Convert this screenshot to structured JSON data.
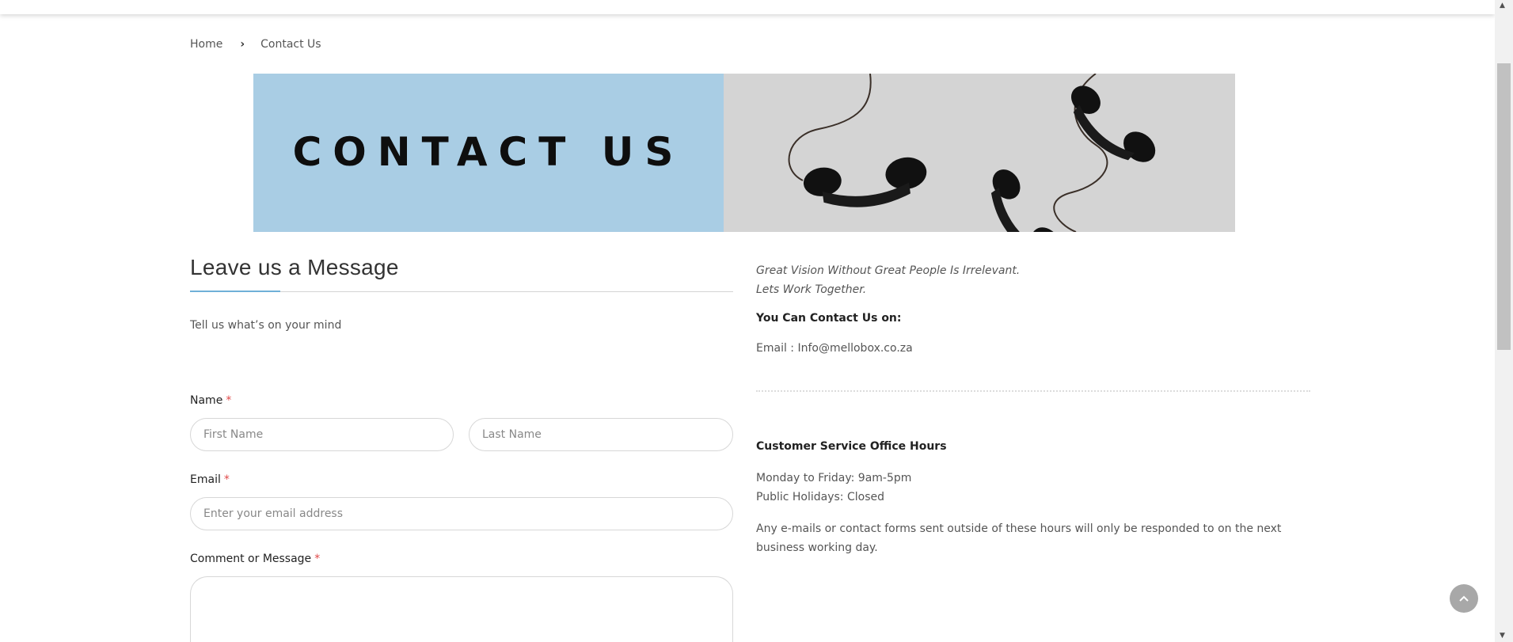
{
  "breadcrumb": {
    "home": "Home",
    "current": "Contact Us"
  },
  "banner": {
    "title": "CONTACT US",
    "bg_left": "#a9cde4",
    "bg_right": "#d4d4d4"
  },
  "form": {
    "title": "Leave us a Message",
    "intro": "Tell us what’s on your mind",
    "name_label": "Name",
    "first_name_placeholder": "First Name",
    "last_name_placeholder": "Last Name",
    "email_label": "Email",
    "email_placeholder": "Enter your email address",
    "message_label": "Comment or Message",
    "required_mark": "*"
  },
  "contact": {
    "quote_line1": "Great Vision Without Great People Is Irrelevant.",
    "quote_line2": "Lets Work Together.",
    "heading": "You Can Contact Us on:",
    "email_line": "Email : Info@mellobox.co.za",
    "hours_heading": "Customer Service Office Hours",
    "hours_weekdays": "Monday to Friday: 9am-5pm",
    "hours_holidays": "Public Holidays: Closed",
    "note": "Any e-mails or contact forms sent outside of these hours will only be responded to on the next business working day."
  },
  "icons": {
    "breadcrumb_separator": "chevron-right-icon",
    "back_to_top": "chevron-up-icon"
  },
  "colors": {
    "accent": "#6fb0d8",
    "required": "#e04848"
  }
}
